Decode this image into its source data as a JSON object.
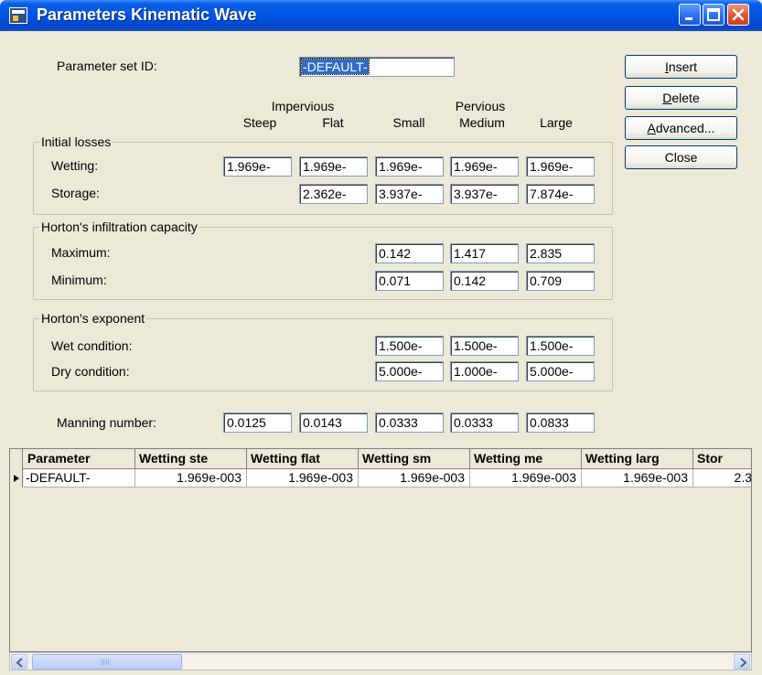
{
  "window": {
    "title": "Parameters Kinematic Wave"
  },
  "form": {
    "param_set_label": "Parameter set ID:",
    "param_set_value": "-DEFAULT-",
    "headers": {
      "impervious": "Impervious",
      "pervious": "Pervious",
      "steep": "Steep",
      "flat": "Flat",
      "small": "Small",
      "medium": "Medium",
      "large": "Large"
    },
    "initial_losses": {
      "title": "Initial losses",
      "wetting_label": "Wetting:",
      "wetting": [
        "1.969e-",
        "1.969e-",
        "1.969e-",
        "1.969e-",
        "1.969e-"
      ],
      "storage_label": "Storage:",
      "storage": [
        "2.362e-",
        "3.937e-",
        "3.937e-",
        "7.874e-"
      ]
    },
    "horton_capacity": {
      "title": "Horton's infiltration capacity",
      "maximum_label": "Maximum:",
      "maximum": [
        "0.142",
        "1.417",
        "2.835"
      ],
      "minimum_label": "Minimum:",
      "minimum": [
        "0.071",
        "0.142",
        "0.709"
      ]
    },
    "horton_exponent": {
      "title": "Horton's exponent",
      "wet_label": "Wet condition:",
      "wet": [
        "1.500e-",
        "1.500e-",
        "1.500e-"
      ],
      "dry_label": "Dry condition:",
      "dry": [
        "5.000e-",
        "1.000e-",
        "5.000e-"
      ]
    },
    "manning_label": "Manning number:",
    "manning": [
      "0.0125",
      "0.0143",
      "0.0333",
      "0.0333",
      "0.0833"
    ]
  },
  "buttons": {
    "insert_pre": "",
    "insert_key": "I",
    "insert_post": "nsert",
    "delete_pre": "",
    "delete_key": "D",
    "delete_post": "elete",
    "advanced_pre": "",
    "advanced_key": "A",
    "advanced_post": "dvanced...",
    "close": "Close"
  },
  "grid": {
    "columns": [
      "Parameter",
      "Wetting ste",
      "Wetting flat",
      "Wetting sm",
      "Wetting me",
      "Wetting larg",
      "Stor"
    ],
    "rows": [
      [
        "-DEFAULT-",
        "1.969e-003",
        "1.969e-003",
        "1.969e-003",
        "1.969e-003",
        "1.969e-003",
        "2.3"
      ]
    ]
  },
  "scrollbar": {
    "left_icon": "arrow-left-icon",
    "right_icon": "arrow-right-icon",
    "grip": "IIII"
  }
}
